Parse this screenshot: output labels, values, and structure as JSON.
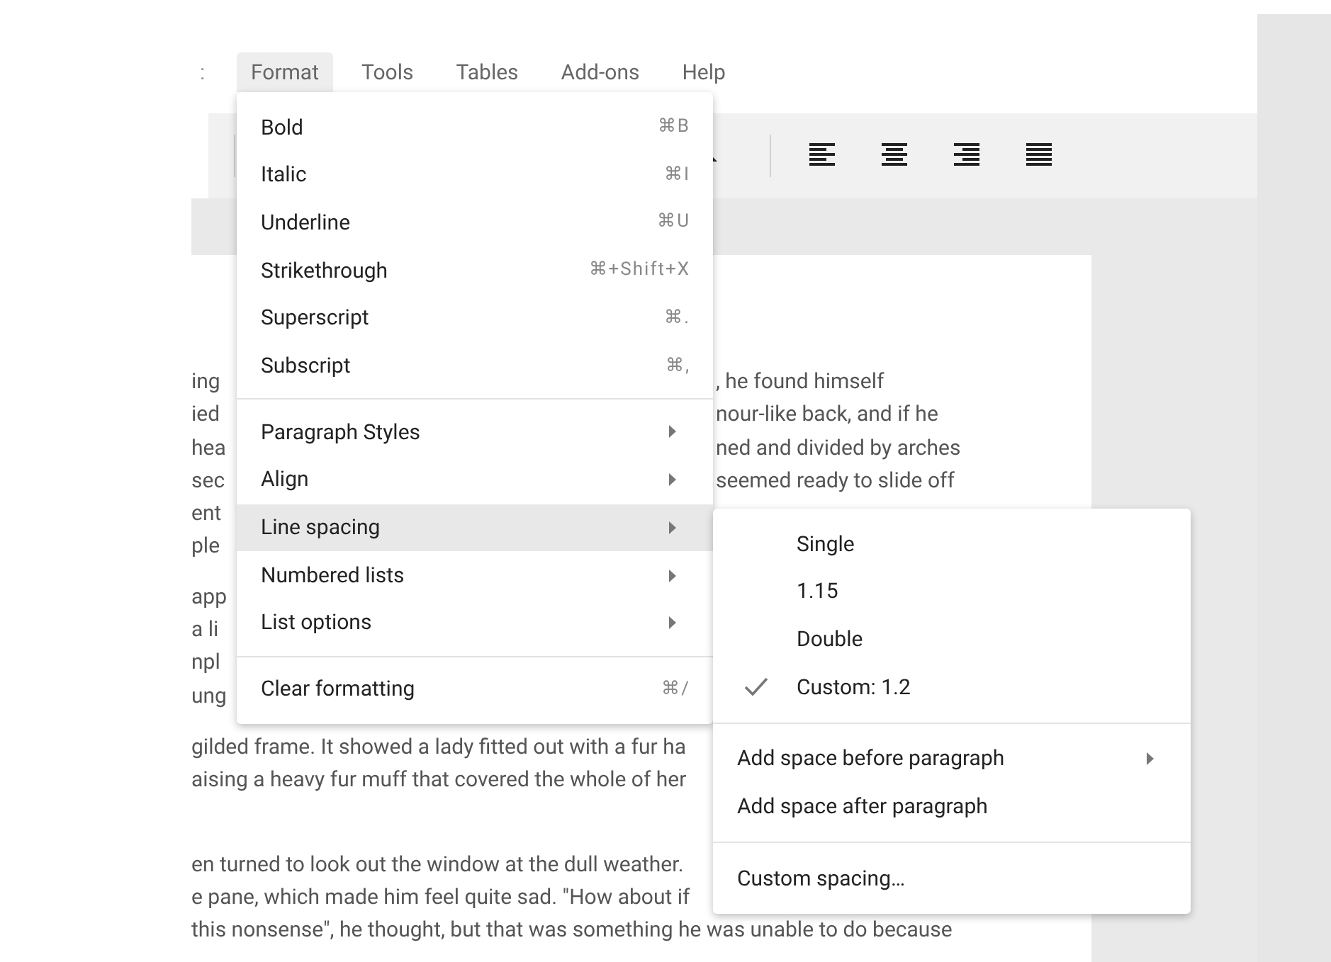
{
  "menu_bar": [
    {
      "label": ":",
      "selected": false
    },
    {
      "label": "Format",
      "selected": true
    },
    {
      "label": "Tools",
      "selected": false
    },
    {
      "label": "Tables",
      "selected": false
    },
    {
      "label": "Add-ons",
      "selected": false
    },
    {
      "label": "Help",
      "selected": false
    }
  ],
  "document": {
    "paragraphs": [
      {
        "lines": [
          {
            "left": "ing",
            "right": ", he found himself"
          },
          {
            "left": "ied",
            "right": "nour-like back, and if he"
          },
          {
            "left": "hea",
            "right": "ned and divided by arches"
          },
          {
            "left": "sec",
            "right": "seemed ready to slide off"
          },
          {
            "left": "ent"
          },
          {
            "left": "ple"
          }
        ]
      },
      {
        "lines": [
          {
            "left": "app"
          },
          {
            "left": "a li"
          },
          {
            "left": "npl"
          },
          {
            "left": "ung"
          }
        ]
      },
      {
        "lines": [
          {
            "left": "gilded frame. It showed a lady fitted out with a fur ha"
          },
          {
            "left": "aising a heavy fur muff that covered the whole of her"
          }
        ]
      },
      {
        "lines": [
          {
            "left": "en turned to look out the window at the dull weather."
          },
          {
            "left": "e pane, which made him feel quite sad. \"How about if"
          },
          {
            "left": "this nonsense\", he thought, but that was something he was unable to do because"
          }
        ]
      }
    ]
  },
  "format_menu": {
    "sections": [
      [
        {
          "label": "Bold",
          "shortcut": "⌘B",
          "submenu": false,
          "selected": false
        },
        {
          "label": "Italic",
          "shortcut": "⌘I",
          "submenu": false,
          "selected": false
        },
        {
          "label": "Underline",
          "shortcut": "⌘U",
          "submenu": false,
          "selected": false
        },
        {
          "label": "Strikethrough",
          "shortcut": "⌘+Shift+X",
          "submenu": false,
          "selected": false
        },
        {
          "label": "Superscript",
          "shortcut": "⌘.",
          "submenu": false,
          "selected": false
        },
        {
          "label": "Subscript",
          "shortcut": "⌘,",
          "submenu": false,
          "selected": false
        }
      ],
      [
        {
          "label": "Paragraph Styles",
          "submenu": true,
          "selected": false
        },
        {
          "label": "Align",
          "submenu": true,
          "selected": false
        },
        {
          "label": "Line spacing",
          "submenu": true,
          "selected": true
        },
        {
          "label": "Numbered lists",
          "submenu": true,
          "selected": false
        },
        {
          "label": "List options",
          "submenu": true,
          "selected": false
        }
      ],
      [
        {
          "label": "Clear formatting",
          "shortcut": "⌘/",
          "submenu": false,
          "selected": false
        }
      ]
    ]
  },
  "line_spacing_menu": {
    "sections": [
      [
        {
          "kind": "option",
          "label": "Single",
          "checked": false
        },
        {
          "kind": "option",
          "label": "1.15",
          "checked": false
        },
        {
          "kind": "option",
          "label": "Double",
          "checked": false
        },
        {
          "kind": "option",
          "label": "Custom: 1.2",
          "checked": true
        }
      ],
      [
        {
          "kind": "action",
          "label": "Add space before paragraph",
          "submenu": true
        },
        {
          "kind": "action",
          "label": "Add space after paragraph",
          "submenu": false
        }
      ],
      [
        {
          "kind": "action",
          "label": "Custom spacing…",
          "submenu": false
        }
      ]
    ]
  }
}
